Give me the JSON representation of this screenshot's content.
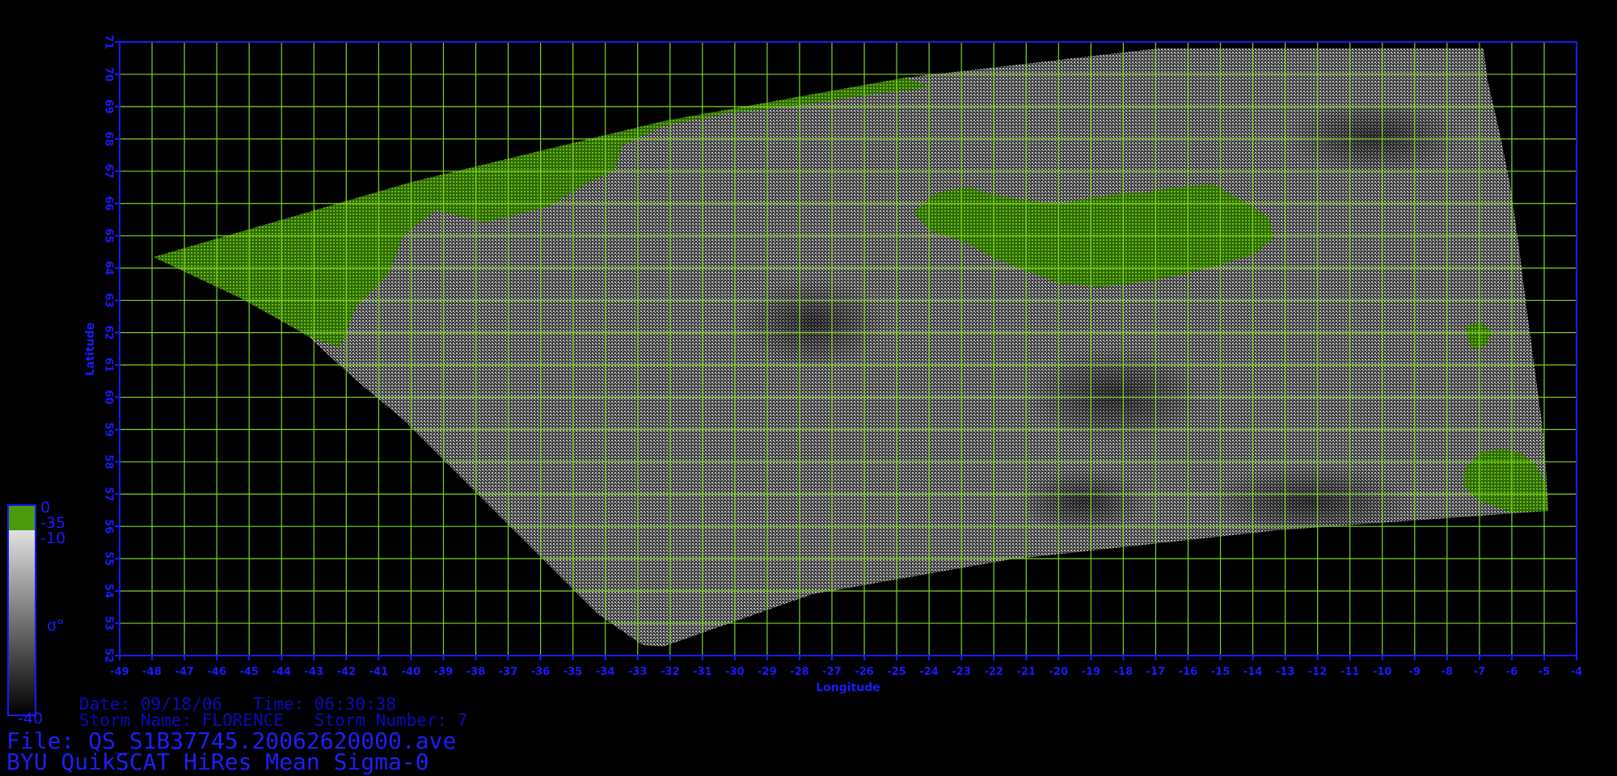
{
  "colors": {
    "background": "#000000",
    "frame": "#1a1aff",
    "grid": "#7fd520",
    "land": "#4a8a0c",
    "text_dim": "#0b0bb8",
    "text_bright": "#1e1eff"
  },
  "map": {
    "longitude_label": "Longitude",
    "latitude_label": "Latitude",
    "lon_range": [
      -49,
      -4
    ],
    "lat_range": [
      52,
      71
    ]
  },
  "legend": {
    "symbol": "σ°",
    "labels": {
      "top": "0",
      "land": "-35",
      "upper": "-10",
      "bottom": "-40"
    },
    "icons": [
      "colorbar-icon"
    ]
  },
  "info": {
    "date_line": "Date: 09/18/06   Time: 06:30:38",
    "storm_line": "Storm Name: FLORENCE   Storm Number: 7",
    "file_line": "File: QS_S1B37745.20062620000.ave",
    "product_line": "BYU QuikSCAT HiRes Mean Sigma-0"
  }
}
